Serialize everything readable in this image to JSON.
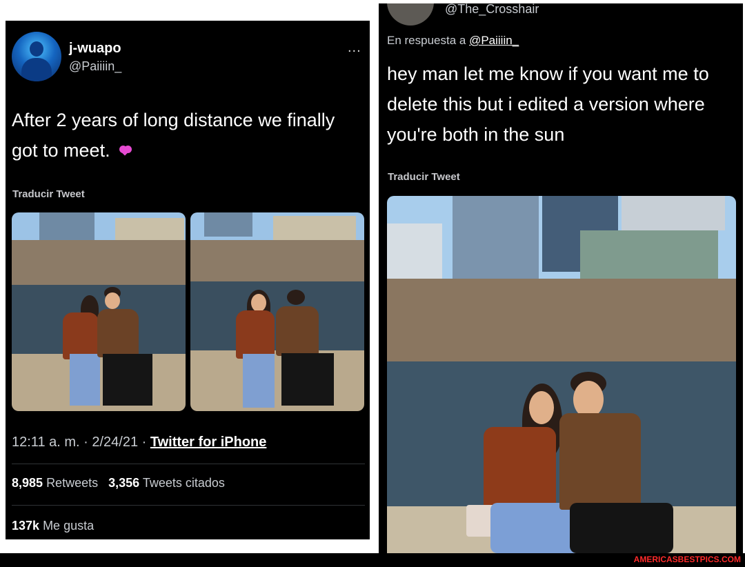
{
  "left_tweet": {
    "display_name": "j-wuapo",
    "handle": "@Paiiiin_",
    "more": "...",
    "text": "After 2 years of long distance we finally got to meet.",
    "heart_icon": "two-hearts-icon",
    "translate": "Traducir Tweet",
    "time_date": "12:11 a. m. · 2/24/21 · ",
    "source": "Twitter for iPhone",
    "retweets_count": "8,985",
    "retweets_label": "Retweets",
    "quotes_count": "3,356",
    "quotes_label": "Tweets citados",
    "likes_count": "137k",
    "likes_label": "Me gusta"
  },
  "right_tweet": {
    "handle": "@The_Crosshair",
    "reply_prefix": "En respuesta a ",
    "reply_mention": "@Paiiiin_",
    "text": "hey man let me know if you want me to delete this but i edited a version where you're both in the sun",
    "translate": "Traducir Tweet"
  },
  "watermark": "AMERICASBESTPICS.COM",
  "colors": {
    "background": "#000000",
    "accent_heart": "#e64bd2",
    "watermark": "#ff2a2a"
  }
}
